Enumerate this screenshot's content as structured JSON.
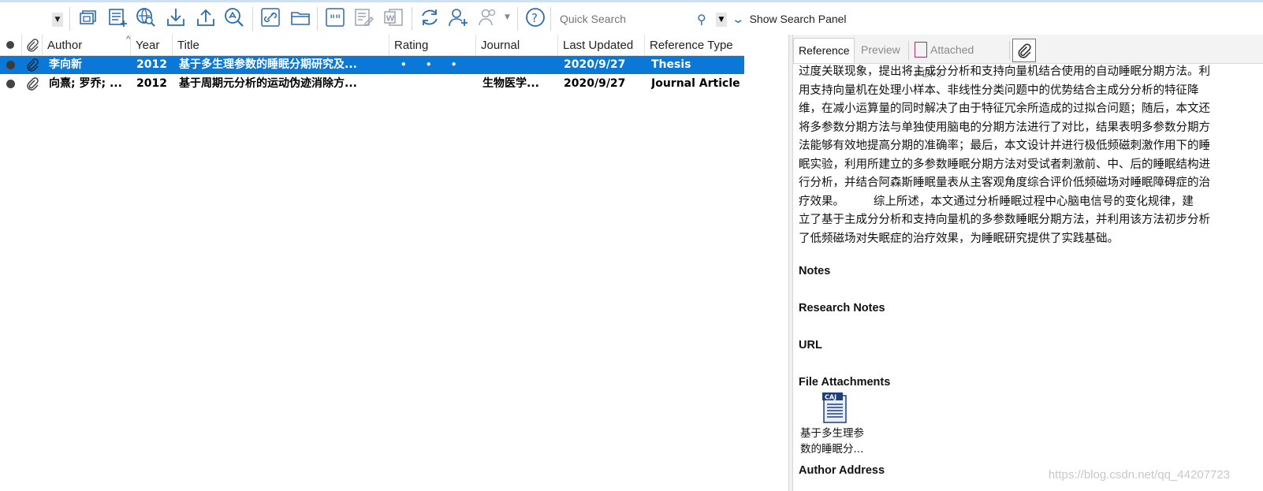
{
  "toolbar": {
    "search_placeholder": "Quick Search",
    "show_search_panel": "Show Search Panel"
  },
  "columns": [
    "Author",
    "Year",
    "Title",
    "Rating",
    "Journal",
    "Last Updated",
    "Reference Type"
  ],
  "rows": [
    {
      "author": "李向新",
      "year": "2012",
      "title": "基于多生理参数的睡眠分期研究及...",
      "rating": "• • • • •",
      "journal": "",
      "last_updated": "2020/9/27",
      "type": "Thesis",
      "selected": true
    },
    {
      "author": "向熹; 罗乔; ...",
      "year": "2012",
      "title": "基于周期元分析的运动伪迹消除方...",
      "rating": "",
      "journal": "生物医学...",
      "last_updated": "2020/9/27",
      "type": "Journal Article",
      "selected": false
    }
  ],
  "tabs": {
    "reference": "Reference",
    "preview": "Preview",
    "attached_pdfs": "Attached PDFs"
  },
  "abstract_lines": [
    "过度关联现象，提出将主成分分析和支持向量机结合使用的自动睡眠分期方法。利",
    "用支持向量机在处理小样本、非线性分类问题中的优势结合主成分分析的特征降",
    "维，在减小运算量的同时解决了由于特征冗余所造成的过拟合问题；随后，本文还",
    "将多参数分期方法与单独使用脑电的分期方法进行了对比，结果表明多参数分期方",
    "法能够有效地提高分期的准确率；最后，本文设计并进行极低频磁刺激作用下的睡",
    "眠实验，利用所建立的多参数睡眠分期方法对受试者刺激前、中、后的睡眠结构进",
    "行分析，并结合阿森斯睡眠量表从主客观角度综合评价低频磁场对睡眠障碍症的治",
    "疗效果。        综上所述，本文通过分析睡眠过程中心脑电信号的变化规律，建",
    "立了基于主成分分析和支持向量机的多参数睡眠分期方法，并利用该方法初步分析",
    "了低频磁场对失眠症的治疗效果，为睡眠研究提供了实践基础。"
  ],
  "fields": {
    "notes": "Notes",
    "research_notes": "Research Notes",
    "url": "URL",
    "file_attachments": "File Attachments",
    "author_address": "Author Address"
  },
  "attachment": {
    "name_line1": "基于多生理参",
    "name_line2": "数的睡眠分...",
    "icon_label": "CAJ"
  },
  "watermark": "https://blog.csdn.net/qq_44207723",
  "colors": {
    "selection": "#0a78d7",
    "accent": "#2b6ab0"
  }
}
